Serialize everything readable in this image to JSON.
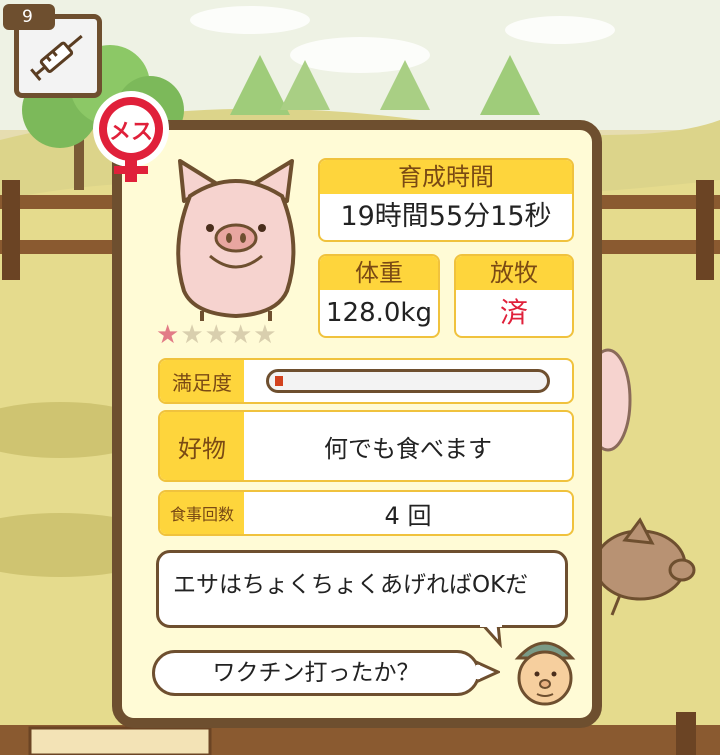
{
  "counter": "9",
  "stats": {
    "growth_time_label": "育成時間",
    "growth_time_value": "19時間55分15秒",
    "weight_label": "体重",
    "weight_value": "128.0kg",
    "grazing_label": "放牧",
    "grazing_value": "済"
  },
  "rating": {
    "stars": 5,
    "filled": 1,
    "display": "★★★★★"
  },
  "satisfaction": {
    "label": "満足度",
    "level": 0.03
  },
  "favorite": {
    "label": "好物",
    "value": "何でも食べます"
  },
  "meals": {
    "label": "食事回数",
    "value": "4 回"
  },
  "messages": {
    "top": "エサはちょくちょくあげればOKだ",
    "bottom": "ワクチン打ったか？"
  },
  "gender_badge": "メス",
  "colors": {
    "frame": "#6e4f2f",
    "header_yellow": "#fed53c",
    "accent_red": "#e0203a",
    "pig_pink": "#f6d3cf"
  }
}
